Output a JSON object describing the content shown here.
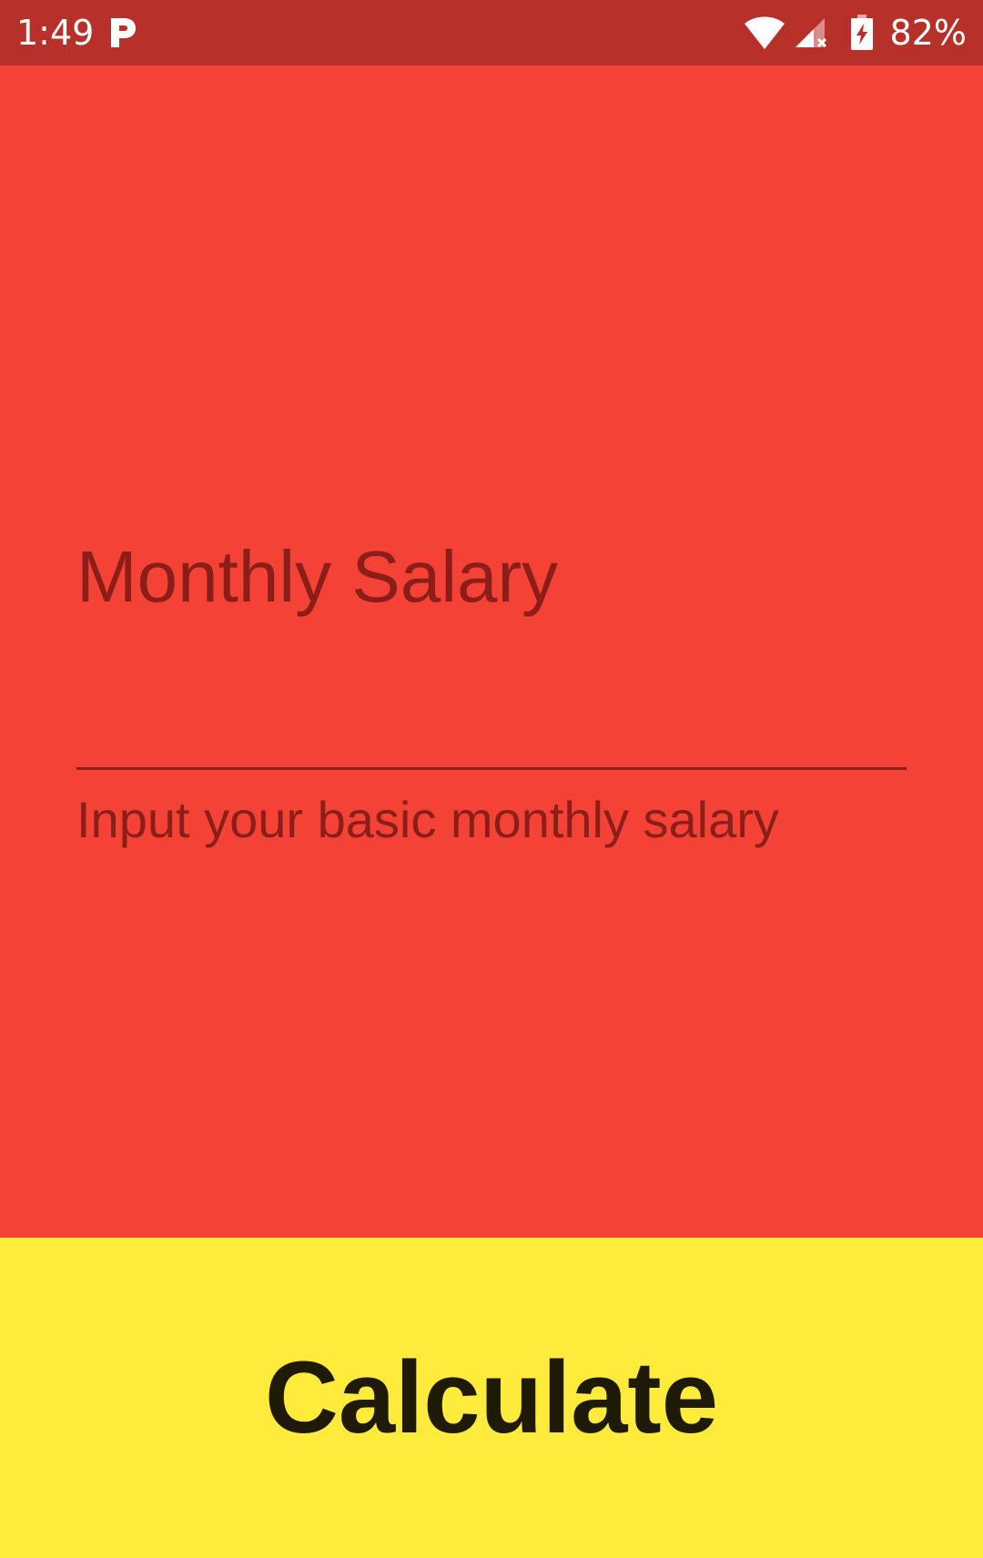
{
  "status_bar": {
    "time": "1:49",
    "battery_percent": "82%",
    "icons": [
      "p-app-icon",
      "wifi-icon",
      "signal-no-data-icon",
      "battery-charging-icon"
    ]
  },
  "form": {
    "label": "Monthly Salary",
    "input_value": "",
    "helper_text": "Input your basic monthly salary"
  },
  "button": {
    "label": "Calculate"
  },
  "colors": {
    "status_bar": "#b7312a",
    "background": "#f44336",
    "text": "#8b1e18",
    "button_background": "#ffeb3b",
    "button_text": "#1f1a05"
  }
}
